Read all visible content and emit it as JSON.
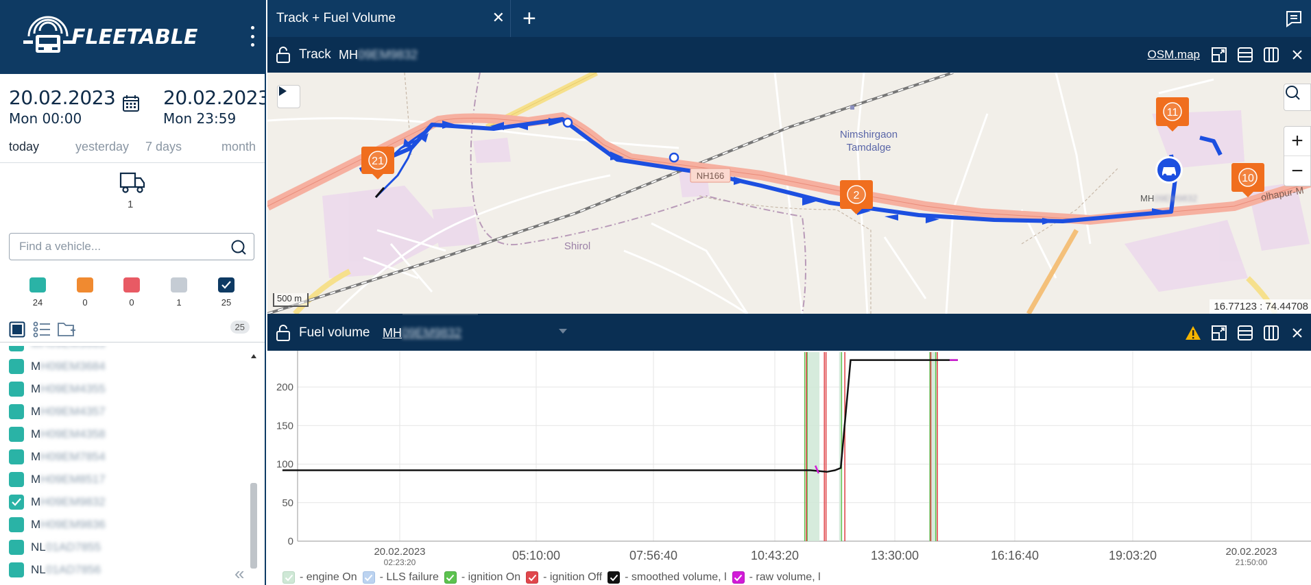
{
  "brand": {
    "name": "FLEETABLE"
  },
  "dates": {
    "from_date": "20.02.2023",
    "from_time": "Mon 00:00",
    "to_date": "20.02.2023",
    "to_time": "Mon 23:59",
    "quick": [
      "today",
      "yesterday",
      "7 days",
      "month"
    ]
  },
  "vehicle_count": "1",
  "search": {
    "placeholder": "Find a vehicle..."
  },
  "statuses": [
    {
      "color": "#2ab3a6",
      "count": "24"
    },
    {
      "color": "#f08a30",
      "count": "0"
    },
    {
      "color": "#e85a64",
      "count": "0"
    },
    {
      "color": "#c5ccd4",
      "count": "1"
    },
    {
      "color": "#0e3a63",
      "count": "25"
    }
  ],
  "list_total": "25",
  "vehicles": [
    {
      "prefix": "M",
      "rest": "H09EM3684",
      "checked": false
    },
    {
      "prefix": "M",
      "rest": "H09EM4355",
      "checked": false
    },
    {
      "prefix": "M",
      "rest": "H09EM4357",
      "checked": false
    },
    {
      "prefix": "M",
      "rest": "H09EM4358",
      "checked": false
    },
    {
      "prefix": "M",
      "rest": "H09EM7854",
      "checked": false
    },
    {
      "prefix": "M",
      "rest": "H09EM8517",
      "checked": false
    },
    {
      "prefix": "M",
      "rest": "H09EM9832",
      "checked": true
    },
    {
      "prefix": "M",
      "rest": "H09EM9836",
      "checked": false
    },
    {
      "prefix": "NL",
      "rest": "01AD7855",
      "checked": false
    },
    {
      "prefix": "NL",
      "rest": "01AD7856",
      "checked": false
    }
  ],
  "tab": {
    "title": "Track + Fuel Volume"
  },
  "track_panel": {
    "title": "Track",
    "vehicle_prefix": "MH",
    "vehicle_rest": "09EM9832",
    "map_source": "OSM.map"
  },
  "map": {
    "labels": {
      "village": "Nimshirgaon\nTamdalge",
      "village1": "Nimshirgaon",
      "village2": "Tamdalge",
      "road": "NH166",
      "town": "Shirol",
      "road2": "olhapur-M",
      "vehicle_label_prefix": "MH",
      "vehicle_label_rest": "09EM9832"
    },
    "markers": [
      "21",
      "2",
      "11",
      "10"
    ],
    "scale": "500 m",
    "coords": "16.77123 : 74.44708"
  },
  "fuel_panel": {
    "title": "Fuel volume",
    "vehicle_prefix": "MH",
    "vehicle_rest": "09EM9832"
  },
  "chart_data": {
    "type": "line",
    "title": "",
    "xlabel": "",
    "ylabel": "",
    "ylim": [
      0,
      240
    ],
    "y_ticks": [
      "0",
      "50",
      "100",
      "150",
      "200"
    ],
    "x_ticks": [
      {
        "label": "20.02.2023",
        "sub": "02:23:20"
      },
      {
        "label": "05:10:00",
        "sub": ""
      },
      {
        "label": "07:56:40",
        "sub": ""
      },
      {
        "label": "10:43:20",
        "sub": ""
      },
      {
        "label": "13:30:00",
        "sub": ""
      },
      {
        "label": "16:16:40",
        "sub": ""
      },
      {
        "label": "19:03:20",
        "sub": ""
      },
      {
        "label": "20.02.2023",
        "sub": "21:50:00"
      }
    ],
    "series": [
      {
        "name": "smoothed volume, l",
        "color": "#111111",
        "points": [
          [
            "00:00",
            92
          ],
          [
            "10:45",
            92
          ],
          [
            "11:05",
            90
          ],
          [
            "11:15",
            92
          ],
          [
            "11:22",
            95
          ],
          [
            "11:34",
            235
          ],
          [
            "13:45",
            235
          ]
        ]
      },
      {
        "name": "raw volume, l",
        "color": "#d21bd8",
        "points": [
          [
            "10:51",
            98
          ],
          [
            "10:55",
            88
          ],
          [
            "13:35",
            235
          ],
          [
            "13:45",
            235
          ]
        ]
      }
    ],
    "legend": [
      {
        "label": "- engine On",
        "color": "#cfe8d6",
        "border": "#b8d6c0"
      },
      {
        "label": "- LLS failure",
        "color": "#bcd3f0",
        "border": "#a3bfe3"
      },
      {
        "label": "- ignition On",
        "color": "#5cc24f",
        "border": "#4aa83f"
      },
      {
        "label": "- ignition Off",
        "color": "#e0474c",
        "border": "#c93a3f"
      },
      {
        "label": "- smoothed volume, l",
        "color": "#111111",
        "border": "#111111"
      },
      {
        "label": "- raw volume, l",
        "color": "#d21bd8",
        "border": "#b314b8"
      }
    ]
  }
}
